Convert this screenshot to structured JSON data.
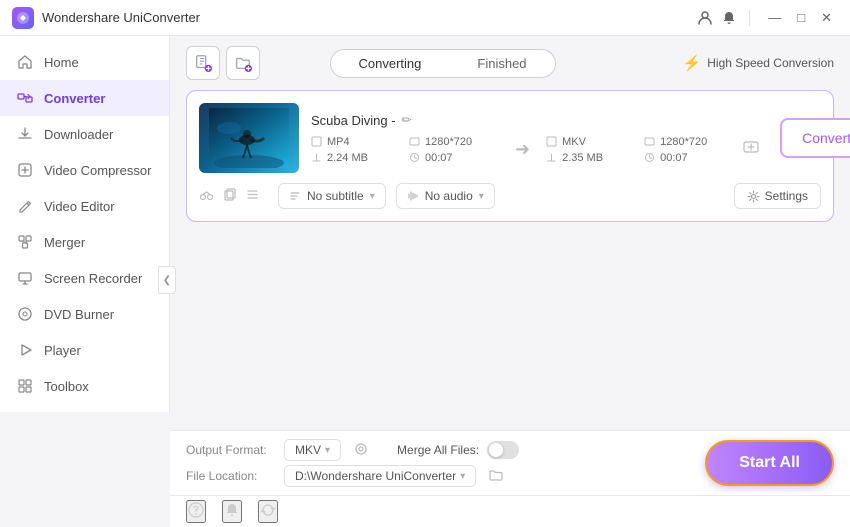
{
  "app": {
    "title": "Wondershare UniConverter",
    "icon": "W"
  },
  "titlebar": {
    "controls": [
      "user-icon",
      "bell-icon",
      "menu-icon",
      "minimize-icon",
      "maximize-icon",
      "close-icon"
    ]
  },
  "sidebar": {
    "items": [
      {
        "id": "home",
        "label": "Home",
        "icon": "⌂"
      },
      {
        "id": "converter",
        "label": "Converter",
        "icon": "⇄",
        "active": true
      },
      {
        "id": "downloader",
        "label": "Downloader",
        "icon": "↓"
      },
      {
        "id": "video-compressor",
        "label": "Video Compressor",
        "icon": "▣"
      },
      {
        "id": "video-editor",
        "label": "Video Editor",
        "icon": "✂"
      },
      {
        "id": "merger",
        "label": "Merger",
        "icon": "⊞"
      },
      {
        "id": "screen-recorder",
        "label": "Screen Recorder",
        "icon": "⊡"
      },
      {
        "id": "dvd-burner",
        "label": "DVD Burner",
        "icon": "◎"
      },
      {
        "id": "player",
        "label": "Player",
        "icon": "▶"
      },
      {
        "id": "toolbox",
        "label": "Toolbox",
        "icon": "⚙"
      }
    ]
  },
  "toolbar": {
    "add_file_tooltip": "Add File",
    "add_file_dropdown_tooltip": "Add file options",
    "tabs": [
      {
        "id": "converting",
        "label": "Converting",
        "active": true
      },
      {
        "id": "finished",
        "label": "Finished",
        "active": false
      }
    ],
    "high_speed_label": "High Speed Conversion"
  },
  "file_card": {
    "title": "Scuba Diving -",
    "input": {
      "format": "MP4",
      "resolution": "1280*720",
      "size": "2.24 MB",
      "duration": "00:07"
    },
    "output": {
      "format": "MKV",
      "resolution": "1280*720",
      "size": "2.35 MB",
      "duration": "00:07"
    },
    "subtitle": "No subtitle",
    "audio": "No audio",
    "settings_label": "Settings",
    "convert_label": "Convert"
  },
  "bottom_bar": {
    "output_format_label": "Output Format:",
    "output_format_value": "MKV",
    "file_location_label": "File Location:",
    "file_location_value": "D:\\Wondershare UniConverter",
    "merge_all_files_label": "Merge All Files:",
    "start_all_label": "Start All"
  },
  "status_bar": {
    "icons": [
      "help-icon",
      "notification-icon",
      "sync-icon"
    ]
  }
}
